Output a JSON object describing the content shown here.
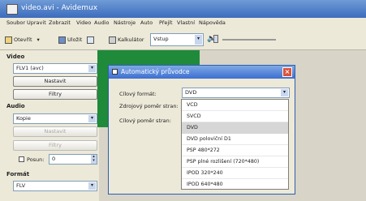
{
  "window": {
    "title": "video.avi - Avidemux"
  },
  "menu": [
    "Soubor",
    "Upravit",
    "Zobrazit",
    "Video",
    "Audio",
    "Nástroje",
    "Auto",
    "Přejít",
    "Vlastní",
    "Nápověda"
  ],
  "toolbar": {
    "open": "Otevřít",
    "save": "Uložit",
    "calculator": "Kalkulátor",
    "input_combo": "Vstup"
  },
  "left": {
    "video_label": "Video",
    "video_codec": "FLV1 (avc)",
    "video_config": "Nastavit",
    "video_filters": "Filtry",
    "audio_label": "Audio",
    "audio_codec": "Kopie",
    "audio_config": "Nastavit",
    "audio_filters": "Filtry",
    "shift_label": "Posun:",
    "shift_value": "0",
    "format_label": "Formát",
    "format_value": "FLV"
  },
  "dialog": {
    "title": "Automatický průvodce",
    "target_label": "Cílový formát:",
    "target_value": "DVD",
    "source_ratio_label": "Zdrojový poměr stran:",
    "target_ratio_label": "Cílový poměr stran:",
    "options": [
      "VCD",
      "SVCD",
      "DVD",
      "DVD poloviční D1",
      "PSP 480*272",
      "PSP plné rozlišení (720*480)",
      "IPOD 320*240",
      "IPOD 640*480"
    ],
    "selected_index": 2
  }
}
